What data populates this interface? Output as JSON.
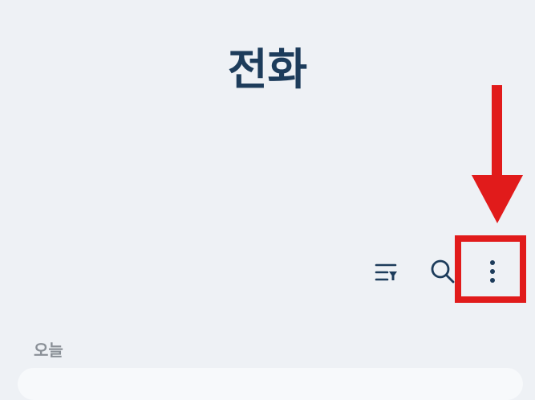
{
  "header": {
    "title": "전화"
  },
  "toolbar": {
    "filter_icon": "filter-list-icon",
    "search_icon": "search-icon",
    "more_icon": "more-vertical-icon"
  },
  "annotation": {
    "arrow_color": "#e11b1b",
    "box_color": "#e11b1b"
  },
  "sections": {
    "today_label": "오늘"
  }
}
